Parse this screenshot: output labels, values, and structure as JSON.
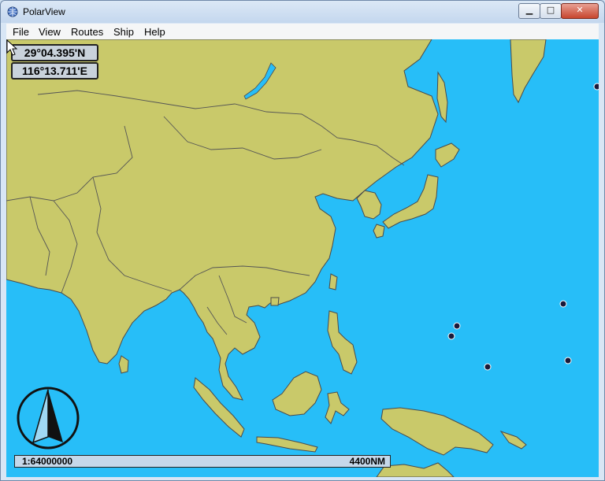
{
  "app": {
    "title": "PolarView"
  },
  "window_controls": {
    "minimize": "▁",
    "maximize": "□",
    "close": "✕"
  },
  "menu": [
    "File",
    "View",
    "Routes",
    "Ship",
    "Help"
  ],
  "position": {
    "latitude": "29°04.395'N",
    "longitude": "116°13.711'E"
  },
  "scale": {
    "ratio": "1:64000000",
    "distance": "4400NM"
  },
  "colors": {
    "water": "#27bef8",
    "land": "#c9c96a",
    "border": "#4a4a4a"
  },
  "icons": {
    "app": "polarview-globe-icon",
    "north_arrow": "north-arrow-icon",
    "cursor": "mouse-pointer-icon",
    "marker": "waypoint-marker-icon"
  }
}
